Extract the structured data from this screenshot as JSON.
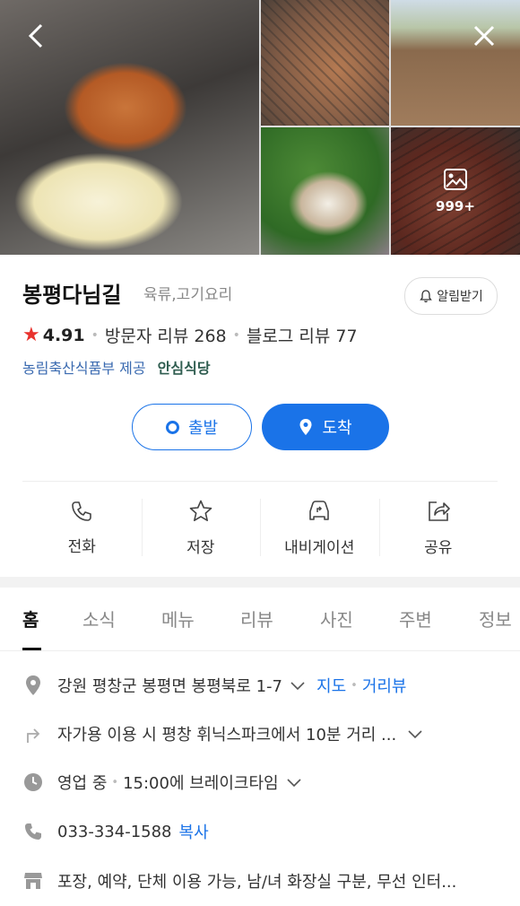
{
  "gallery": {
    "more_count": "999+"
  },
  "place": {
    "name": "봉평다님길",
    "category": "육류,고기요리",
    "notify_label": "알림받기"
  },
  "rating": {
    "score": "4.91",
    "visitor_reviews": "방문자 리뷰 268",
    "blog_reviews": "블로그 리뷰 77"
  },
  "provider": {
    "text": "농림축산식품부 제공",
    "badge": "안심식당"
  },
  "route": {
    "start_label": "출발",
    "arrive_label": "도착"
  },
  "actions": [
    {
      "label": "전화"
    },
    {
      "label": "저장"
    },
    {
      "label": "내비게이션"
    },
    {
      "label": "공유"
    }
  ],
  "tabs": [
    "홈",
    "소식",
    "메뉴",
    "리뷰",
    "사진",
    "주변",
    "정보"
  ],
  "details": {
    "address": "강원 평창군 봉평면 봉평북로 1-7",
    "map_link": "지도",
    "street_view_link": "거리뷰",
    "directions": "자가용 이용 시 평창 휘닉스파크에서 10분 거리 ...",
    "status": "영업 중",
    "break_time": "15:00에 브레이크타임",
    "phone": "033-334-1588",
    "copy_label": "복사",
    "amenities": "포장, 예약, 단체 이용 가능, 남/녀 화장실 구분, 무선 인터..."
  },
  "colors": {
    "accent": "#1a73e8",
    "star": "#e8322d"
  }
}
